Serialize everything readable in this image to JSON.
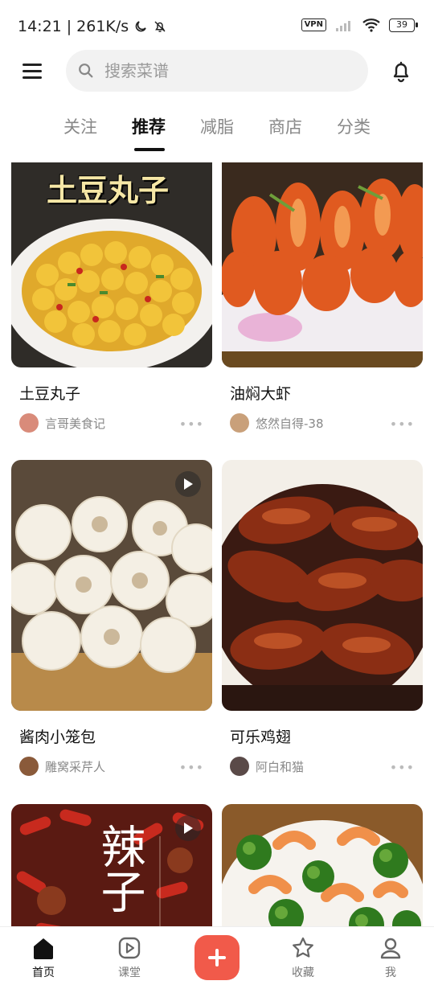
{
  "status_bar": {
    "time": "14:21",
    "separator": "|",
    "speed": "261K/s",
    "vpn": "VPN",
    "battery": "39"
  },
  "search": {
    "placeholder": "搜索菜谱"
  },
  "tabs": [
    {
      "label": "关注",
      "active": false
    },
    {
      "label": "推荐",
      "active": true
    },
    {
      "label": "减脂",
      "active": false
    },
    {
      "label": "商店",
      "active": false
    },
    {
      "label": "分类",
      "active": false
    }
  ],
  "feed": [
    {
      "title": "土豆丸子",
      "author": "言哥美食记",
      "overlay_text": "土豆丸子",
      "has_video": false
    },
    {
      "title": "油焖大虾",
      "author": "悠然自得-38",
      "has_video": false
    },
    {
      "title": "酱肉小笼包",
      "author": "雕窝采芹人",
      "has_video": true
    },
    {
      "title": "可乐鸡翅",
      "author": "阿白和猫",
      "has_video": false
    },
    {
      "title": "",
      "author": "",
      "overlay_text": "辣子",
      "has_video": true
    },
    {
      "title": "",
      "author": "",
      "has_video": false
    }
  ],
  "more_label": "•••",
  "bottom_nav": [
    {
      "label": "首页",
      "icon": "home-icon",
      "active": true
    },
    {
      "label": "课堂",
      "icon": "play-square-icon",
      "active": false
    },
    {
      "label": "",
      "icon": "plus-icon",
      "active": false
    },
    {
      "label": "收藏",
      "icon": "star-icon",
      "active": false
    },
    {
      "label": "我",
      "icon": "person-icon",
      "active": false
    }
  ],
  "colors": {
    "accent": "#f15a4a",
    "active_text": "#111111",
    "inactive_text": "#888888"
  }
}
